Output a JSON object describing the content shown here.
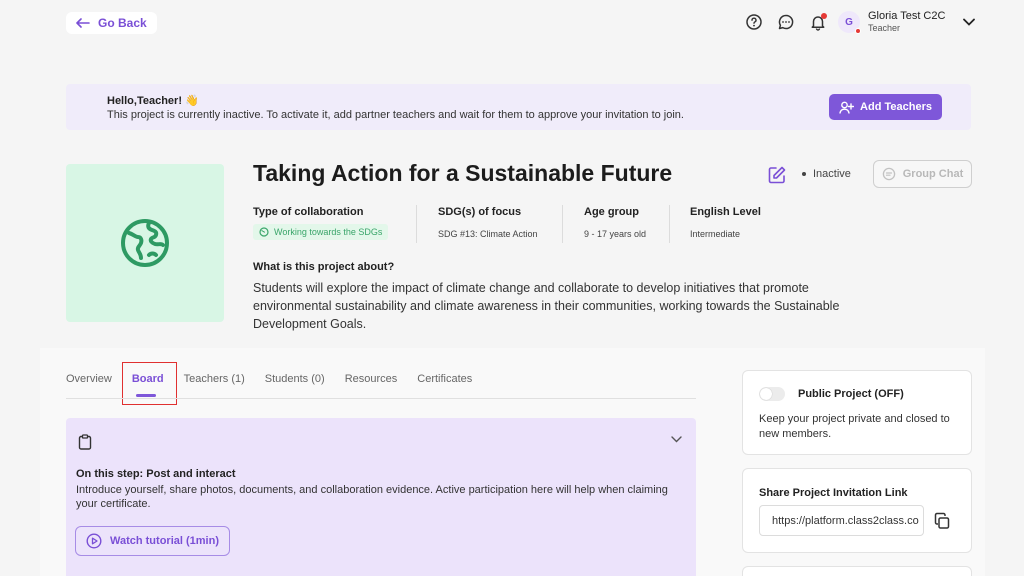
{
  "header": {
    "go_back": "Go Back",
    "user": {
      "initial": "G",
      "name": "Gloria Test C2C",
      "role": "Teacher"
    }
  },
  "banner": {
    "title": "Hello,Teacher! 👋",
    "text": "This project is currently inactive. To activate it, add partner teachers and wait for them to approve your invitation to join.",
    "add_teachers": "Add Teachers"
  },
  "project": {
    "title": "Taking Action for a Sustainable Future",
    "status": "Inactive",
    "group_chat": "Group Chat",
    "collab_label": "Type of collaboration",
    "collab_value": "Working towards the SDGs",
    "sdg_label": "SDG(s) of focus",
    "sdg_value": "SDG #13: Climate Action",
    "age_label": "Age group",
    "age_value": "9 - 17 years old",
    "english_label": "English Level",
    "english_value": "Intermediate",
    "about_label": "What is this project about?",
    "about_text": "Students will explore the impact of climate change and collaborate to develop initiatives that promote environmental sustainability and climate awareness in their communities, working towards the Sustainable Development Goals."
  },
  "tabs": [
    "Overview",
    "Board",
    "Teachers (1)",
    "Students (0)",
    "Resources",
    "Certificates"
  ],
  "active_tab": "Board",
  "step": {
    "title": "On this step: Post and interact",
    "text": "Introduce yourself, share photos, documents, and collaboration evidence. Active participation here will help when claiming your certificate.",
    "watch": "Watch tutorial (1min)"
  },
  "sidebar": {
    "public_title": "Public Project (OFF)",
    "public_text": "Keep your project private and closed to new members.",
    "share_title": "Share Project Invitation Link",
    "share_link": "https://platform.class2class.co"
  },
  "colors": {
    "accent": "#7e57d9",
    "sdg_green": "#3aa56a",
    "project_bg": "#d8f6e5"
  }
}
